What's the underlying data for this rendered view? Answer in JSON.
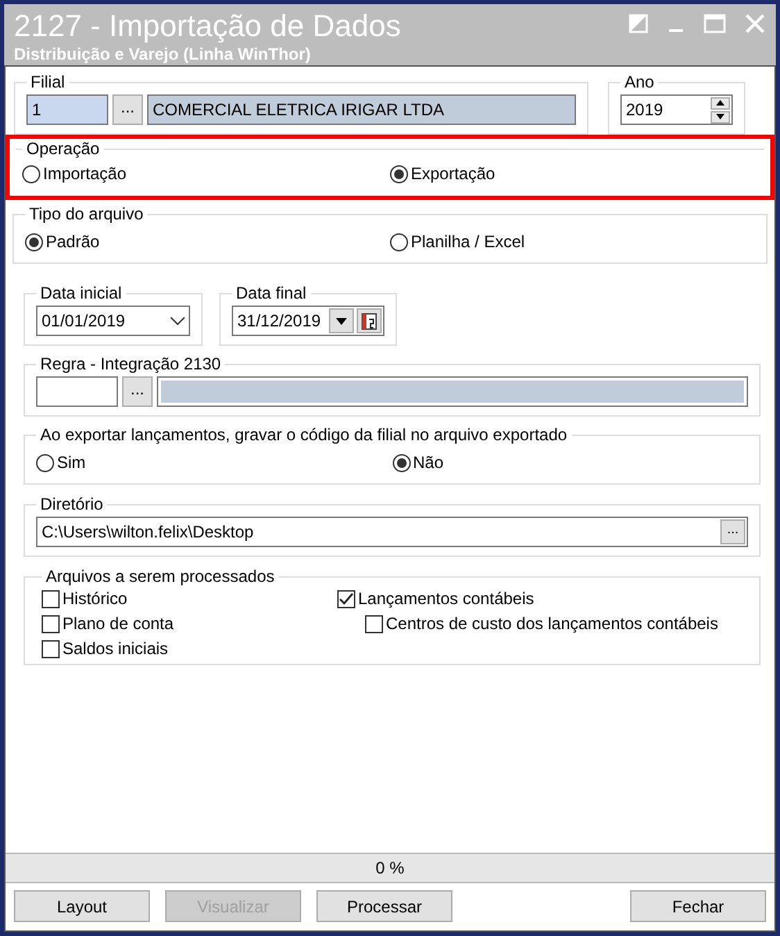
{
  "window": {
    "title": "2127 - Importação de Dados",
    "subtitle": "Distribuição e Varejo (Linha WinThor)"
  },
  "filial": {
    "label": "Filial",
    "code": "1",
    "name": "COMERCIAL ELETRICA IRIGAR LTDA",
    "browse": "..."
  },
  "ano": {
    "label": "Ano",
    "value": "2019"
  },
  "operacao": {
    "label": "Operação",
    "highlighted": true,
    "options": [
      {
        "label": "Importação",
        "selected": false
      },
      {
        "label": "Exportação",
        "selected": true
      }
    ]
  },
  "tipo_arquivo": {
    "label": "Tipo do arquivo",
    "options": [
      {
        "label": "Padrão",
        "selected": true
      },
      {
        "label": "Planilha / Excel",
        "selected": false
      }
    ]
  },
  "data_inicial": {
    "label": "Data inicial",
    "value": "01/01/2019"
  },
  "data_final": {
    "label": "Data final",
    "value": "31/12/2019"
  },
  "regra": {
    "label": "Regra - Integração 2130",
    "browse": "..."
  },
  "gravar_codigo": {
    "label": "Ao exportar lançamentos, gravar o código da filial no arquivo exportado",
    "options": [
      {
        "label": "Sim",
        "selected": false
      },
      {
        "label": "Não",
        "selected": true
      }
    ]
  },
  "diretorio": {
    "label": "Diretório",
    "value": "C:\\Users\\wilton.felix\\Desktop",
    "browse": "..."
  },
  "arquivos": {
    "label": "Arquivos a serem processados",
    "columns": [
      [
        {
          "label": "Histórico",
          "checked": false
        },
        {
          "label": "Plano de conta",
          "checked": false
        },
        {
          "label": "Saldos iniciais",
          "checked": false
        }
      ],
      [
        {
          "label": "Lançamentos contábeis",
          "checked": true,
          "children": [
            {
              "label": "Centros de custo dos lançamentos contábeis",
              "checked": false
            }
          ]
        }
      ]
    ]
  },
  "progress": {
    "level": 0,
    "text": "0 %"
  },
  "buttons": [
    {
      "label": "Layout",
      "disabled": false
    },
    {
      "label": "Visualizar",
      "disabled": true
    },
    {
      "label": "Processar",
      "disabled": false
    },
    {
      "label": "Fechar",
      "disabled": false
    }
  ]
}
